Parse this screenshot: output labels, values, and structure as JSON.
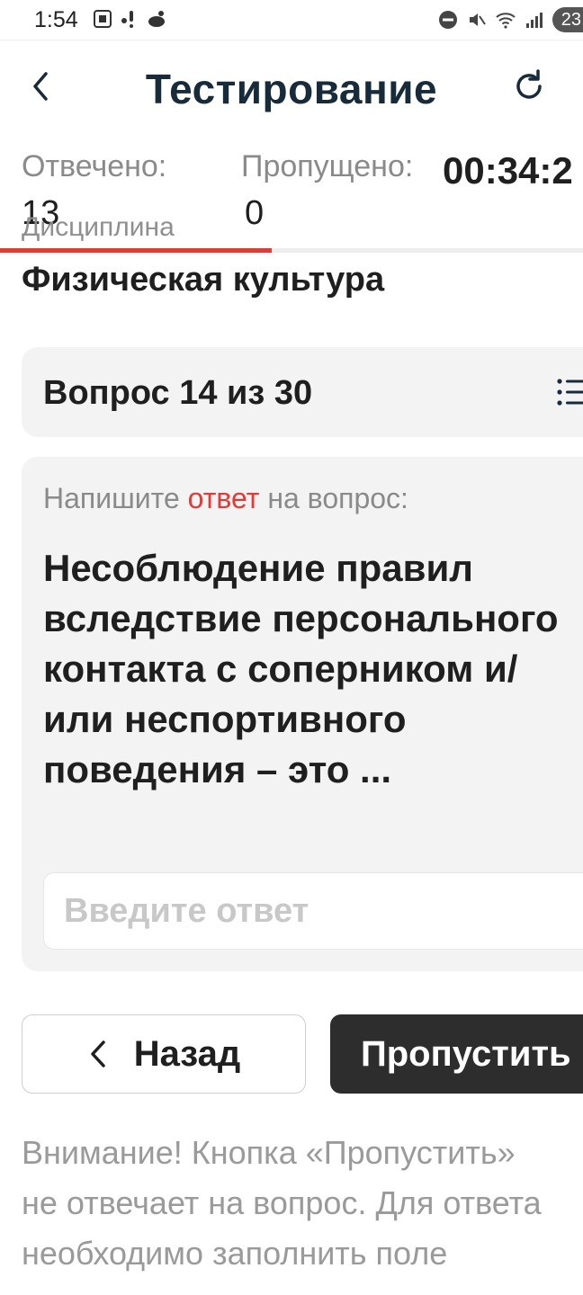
{
  "status_bar": {
    "time": "1:54",
    "battery_badge": "23",
    "left_icons": [
      "screenshot-icon",
      "signal-dots-icon",
      "notification-app-icon"
    ],
    "right_icons": [
      "do-not-disturb-icon",
      "mute-icon",
      "wifi-icon",
      "cellular-signal-icon",
      "battery-icon"
    ]
  },
  "header": {
    "title": "Тестирование",
    "back_icon": "chevron-left-icon",
    "refresh_icon": "refresh-icon"
  },
  "stats": {
    "answered_label": "Отвечено:",
    "answered_value": "13",
    "skipped_label": "Пропущено:",
    "skipped_value": "0",
    "timer": "00:34:2",
    "progress_fraction": 0.4667,
    "accent_color": "#e53935"
  },
  "discipline": {
    "label": "Дисциплина",
    "value": "Физическая культура"
  },
  "question_counter": {
    "text": "Вопрос 14 из 30",
    "list_icon": "list-icon"
  },
  "question": {
    "hint_before": "Напишите",
    "hint_accent": "ответ",
    "hint_after": "на вопрос:",
    "text": "Несоблюдение правил вследствие персонального контакта с соперником и/или неспортивного поведения – это ...",
    "answer_placeholder": "Введите ответ",
    "answer_value": ""
  },
  "buttons": {
    "back_label": "Назад",
    "skip_label": "Пропустить"
  },
  "warning": "Внимание! Кнопка «Пропустить» не отвечает на вопрос. Для ответа необходимо заполнить поле"
}
